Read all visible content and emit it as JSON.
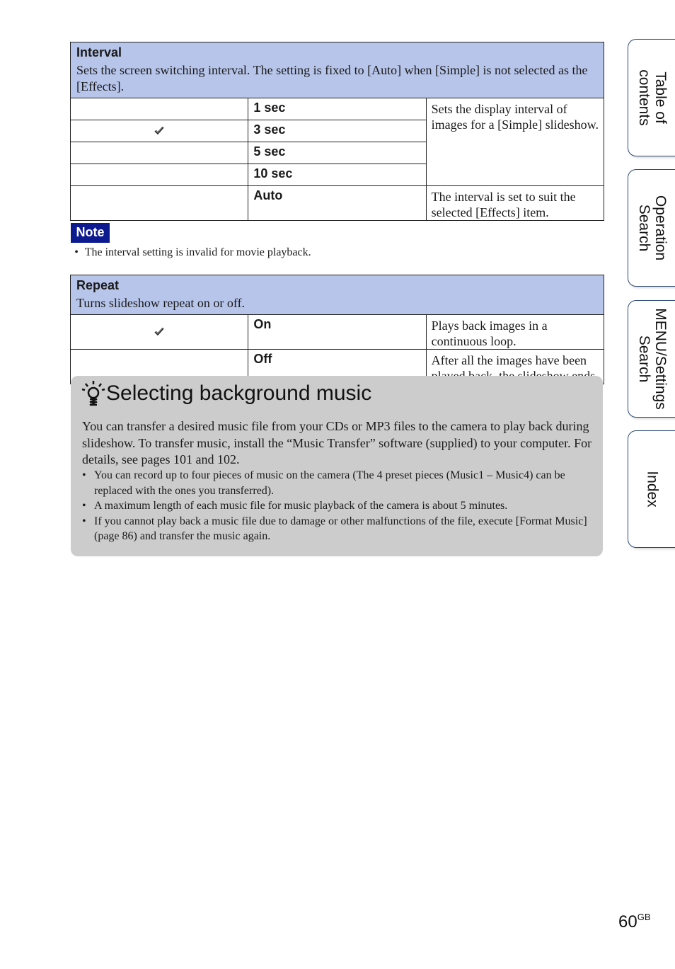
{
  "interval": {
    "title": "Interval",
    "description": "Sets the screen switching interval. The setting is fixed to [Auto] when [Simple] is not selected as the [Effects].",
    "options": [
      {
        "label": "1 sec",
        "selected": false
      },
      {
        "label": "3 sec",
        "selected": true
      },
      {
        "label": "5 sec",
        "selected": false
      },
      {
        "label": "10 sec",
        "selected": false
      },
      {
        "label": "Auto",
        "selected": false
      }
    ],
    "group_description": "Sets the display interval of images for a [Simple] slideshow.",
    "auto_description": "The interval is set to suit the selected [Effects] item."
  },
  "note": {
    "badge": "Note",
    "bullet": "•",
    "text": "The interval setting is invalid for movie playback."
  },
  "repeat": {
    "title": "Repeat",
    "description": "Turns slideshow repeat on or off.",
    "options": [
      {
        "label": "On",
        "selected": true,
        "description": "Plays back images in a continuous loop."
      },
      {
        "label": "Off",
        "selected": false,
        "description": "After all the images have been played back, the slideshow ends."
      }
    ]
  },
  "tip": {
    "icon": "lightbulb-icon",
    "title": "Selecting background music",
    "body": "You can transfer a desired music file from your CDs or MP3 files to the camera to play back during slideshow. To transfer music, install the “Music Transfer” software (supplied) to your computer. For details, see pages 101 and 102.",
    "bullets": [
      "You can record up to four pieces of music on the camera (The 4 preset pieces (Music1 – Music4) can be replaced with the ones you transferred).",
      "A maximum length of each music file for music playback of the camera is about 5 minutes.",
      "If you cannot play back a music file due to damage or other malfunctions of the file, execute [Format Music] (page 86) and transfer the music again."
    ]
  },
  "side_tabs": [
    {
      "label": "Table of\ncontents"
    },
    {
      "label": "Operation\nSearch"
    },
    {
      "label": "MENU/Settings\nSearch"
    },
    {
      "label": "Index"
    }
  ],
  "page": {
    "number": "60",
    "suffix": "GB"
  },
  "colors": {
    "header_bg": "#b7c5ea",
    "note_bg": "#0d1a8f",
    "tip_bg": "#cccccc",
    "tab_border": "#2d4a7a"
  }
}
